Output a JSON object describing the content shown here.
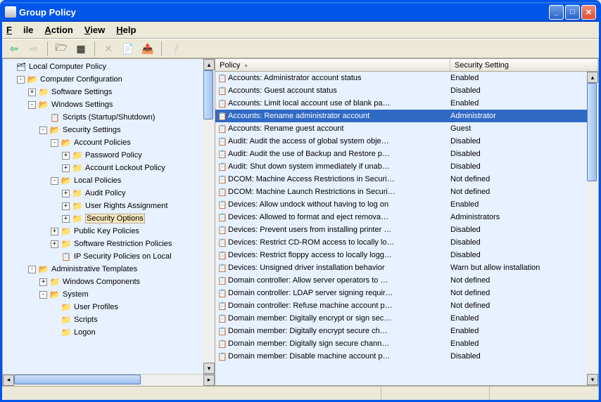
{
  "window": {
    "title": "Group Policy"
  },
  "menu": {
    "file": "File",
    "action": "Action",
    "view": "View",
    "help": "Help"
  },
  "tree": {
    "root": "Local Computer Policy",
    "items": [
      {
        "depth": 0,
        "exp": "none",
        "icon": "root",
        "label": "Local Computer Policy"
      },
      {
        "depth": 1,
        "exp": "minus",
        "icon": "open",
        "label": "Computer Configuration"
      },
      {
        "depth": 2,
        "exp": "plus",
        "icon": "closed",
        "label": "Software Settings"
      },
      {
        "depth": 2,
        "exp": "minus",
        "icon": "open",
        "label": "Windows Settings"
      },
      {
        "depth": 3,
        "exp": "none",
        "icon": "policy",
        "label": "Scripts (Startup/Shutdown)"
      },
      {
        "depth": 3,
        "exp": "minus",
        "icon": "open",
        "label": "Security Settings"
      },
      {
        "depth": 4,
        "exp": "minus",
        "icon": "open",
        "label": "Account Policies"
      },
      {
        "depth": 5,
        "exp": "plus",
        "icon": "closed",
        "label": "Password Policy"
      },
      {
        "depth": 5,
        "exp": "plus",
        "icon": "closed",
        "label": "Account Lockout Policy"
      },
      {
        "depth": 4,
        "exp": "minus",
        "icon": "open",
        "label": "Local Policies"
      },
      {
        "depth": 5,
        "exp": "plus",
        "icon": "closed",
        "label": "Audit Policy"
      },
      {
        "depth": 5,
        "exp": "plus",
        "icon": "closed",
        "label": "User Rights Assignment"
      },
      {
        "depth": 5,
        "exp": "plus",
        "icon": "closed",
        "label": "Security Options",
        "selected": true
      },
      {
        "depth": 4,
        "exp": "plus",
        "icon": "closed",
        "label": "Public Key Policies"
      },
      {
        "depth": 4,
        "exp": "plus",
        "icon": "closed",
        "label": "Software Restriction Policies"
      },
      {
        "depth": 4,
        "exp": "none",
        "icon": "policy",
        "label": "IP Security Policies on Local"
      },
      {
        "depth": 2,
        "exp": "minus",
        "icon": "open",
        "label": "Administrative Templates"
      },
      {
        "depth": 3,
        "exp": "plus",
        "icon": "closed",
        "label": "Windows Components"
      },
      {
        "depth": 3,
        "exp": "minus",
        "icon": "open",
        "label": "System"
      },
      {
        "depth": 4,
        "exp": "none",
        "icon": "closed",
        "label": "User Profiles"
      },
      {
        "depth": 4,
        "exp": "none",
        "icon": "closed",
        "label": "Scripts"
      },
      {
        "depth": 4,
        "exp": "none",
        "icon": "closed",
        "label": "Logon"
      }
    ]
  },
  "list": {
    "columns": {
      "policy": "Policy",
      "setting": "Security Setting"
    },
    "rows": [
      {
        "policy": "Accounts: Administrator account status",
        "setting": "Enabled"
      },
      {
        "policy": "Accounts: Guest account status",
        "setting": "Disabled"
      },
      {
        "policy": "Accounts: Limit local account use of blank pa…",
        "setting": "Enabled"
      },
      {
        "policy": "Accounts: Rename administrator account",
        "setting": "Administrator",
        "selected": true
      },
      {
        "policy": "Accounts: Rename guest account",
        "setting": "Guest"
      },
      {
        "policy": "Audit: Audit the access of global system obje…",
        "setting": "Disabled"
      },
      {
        "policy": "Audit: Audit the use of Backup and Restore p…",
        "setting": "Disabled"
      },
      {
        "policy": "Audit: Shut down system immediately if unab…",
        "setting": "Disabled"
      },
      {
        "policy": "DCOM: Machine Access Restrictions in Securi…",
        "setting": "Not defined"
      },
      {
        "policy": "DCOM: Machine Launch Restrictions in Securi…",
        "setting": "Not defined"
      },
      {
        "policy": "Devices: Allow undock without having to log on",
        "setting": "Enabled"
      },
      {
        "policy": "Devices: Allowed to format and eject remova…",
        "setting": "Administrators"
      },
      {
        "policy": "Devices: Prevent users from installing printer …",
        "setting": "Disabled"
      },
      {
        "policy": "Devices: Restrict CD-ROM access to locally lo…",
        "setting": "Disabled"
      },
      {
        "policy": "Devices: Restrict floppy access to locally logg…",
        "setting": "Disabled"
      },
      {
        "policy": "Devices: Unsigned driver installation behavior",
        "setting": "Warn but allow installation"
      },
      {
        "policy": "Domain controller: Allow server operators to …",
        "setting": "Not defined"
      },
      {
        "policy": "Domain controller: LDAP server signing requir…",
        "setting": "Not defined"
      },
      {
        "policy": "Domain controller: Refuse machine account p…",
        "setting": "Not defined"
      },
      {
        "policy": "Domain member: Digitally encrypt or sign sec…",
        "setting": "Enabled"
      },
      {
        "policy": "Domain member: Digitally encrypt secure ch…",
        "setting": "Enabled"
      },
      {
        "policy": "Domain member: Digitally sign secure chann…",
        "setting": "Enabled"
      },
      {
        "policy": "Domain member: Disable machine account p…",
        "setting": "Disabled"
      }
    ]
  }
}
